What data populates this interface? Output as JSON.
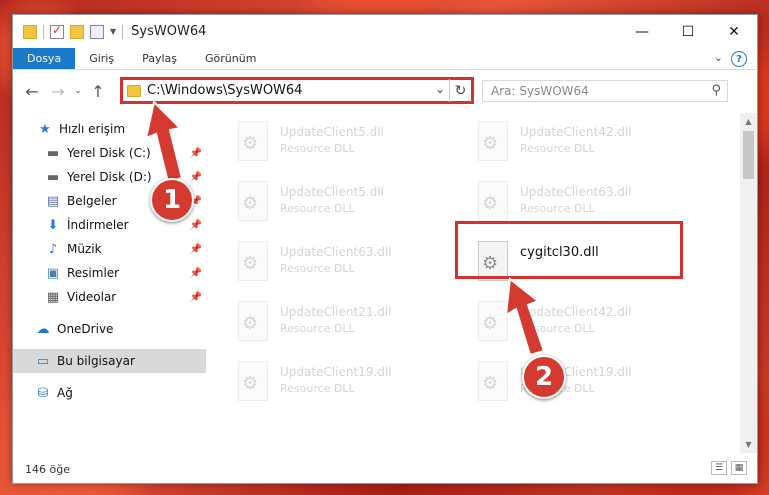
{
  "window": {
    "title": "SysWOW64"
  },
  "window_controls": {
    "minimize": "—",
    "maximize": "☐",
    "close": "✕"
  },
  "ribbon": {
    "tabs": [
      {
        "label": "Dosya",
        "active": true
      },
      {
        "label": "Giriş"
      },
      {
        "label": "Paylaş"
      },
      {
        "label": "Görünüm"
      }
    ],
    "help": "?"
  },
  "address": {
    "path": "C:\\Windows\\SysWOW64"
  },
  "search": {
    "placeholder": "Ara: SysWOW64"
  },
  "navpane": {
    "items": [
      {
        "label": "Hızlı erişim",
        "icon": "star-icon",
        "pinned": false
      },
      {
        "label": "Yerel Disk (C:)",
        "icon": "disk-icon",
        "pinned": true
      },
      {
        "label": "Yerel Disk (D:)",
        "icon": "disk-icon",
        "pinned": true
      },
      {
        "label": "Belgeler",
        "icon": "documents-icon",
        "pinned": true
      },
      {
        "label": "İndirmeler",
        "icon": "download-icon",
        "pinned": true
      },
      {
        "label": "Müzik",
        "icon": "music-icon",
        "pinned": true
      },
      {
        "label": "Resimler",
        "icon": "pictures-icon",
        "pinned": true
      },
      {
        "label": "Videolar",
        "icon": "video-icon",
        "pinned": true
      },
      {
        "label": "OneDrive",
        "icon": "cloud-icon",
        "pinned": false
      },
      {
        "label": "Bu bilgisayar",
        "icon": "computer-icon",
        "pinned": false,
        "selected": true
      },
      {
        "label": "Ağ",
        "icon": "network-icon",
        "pinned": false
      }
    ]
  },
  "files": [
    {
      "name": "UpdateClient5.dll",
      "type": "Resource DLL",
      "blurred": true
    },
    {
      "name": "UpdateClient42.dll",
      "type": "Resource DLL",
      "blurred": true
    },
    {
      "name": "UpdateClient5.dll",
      "type": "Resource DLL",
      "blurred": true
    },
    {
      "name": "UpdateClient63.dll",
      "type": "Resource DLL",
      "blurred": true
    },
    {
      "name": "UpdateClient63.dll",
      "type": "Resource DLL",
      "blurred": true
    },
    {
      "name": "cygitcl30.dll",
      "type": "",
      "blurred": false
    },
    {
      "name": "UpdateClient21.dll",
      "type": "Resource DLL",
      "blurred": true
    },
    {
      "name": "UpdateClient42.dll",
      "type": "Resource DLL",
      "blurred": true
    },
    {
      "name": "UpdateClient19.dll",
      "type": "Resource DLL",
      "blurred": true
    },
    {
      "name": "UpdateClient19.dll",
      "type": "Resource DLL",
      "blurred": true
    }
  ],
  "status": {
    "item_count": "146 öğe"
  },
  "annotations": {
    "step1": "1",
    "step2": "2"
  },
  "colors": {
    "accent": "#1979ca",
    "highlight": "#d6312f"
  }
}
